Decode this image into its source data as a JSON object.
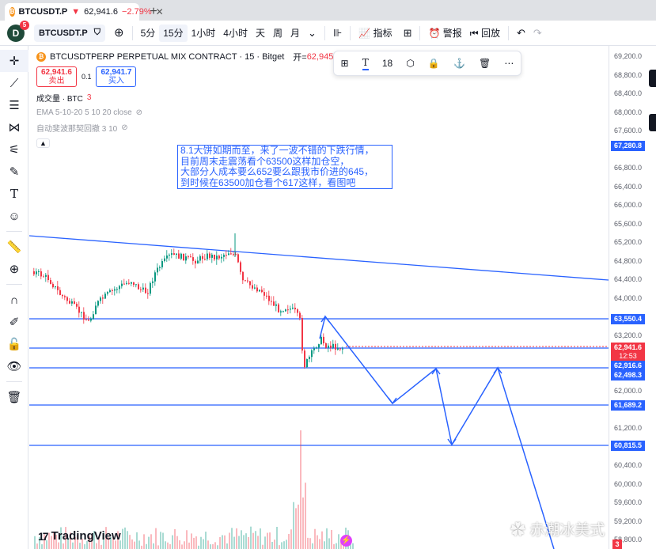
{
  "browser": {
    "tab_symbol": "BTCUSDT.P",
    "tab_price": "62,941.6",
    "tab_change": "−2.79%",
    "tab_close": "✕",
    "new_tab": "+"
  },
  "toolbar": {
    "avatar_letter": "D",
    "notification_count": "5",
    "symbol": "BTCUSDT.P",
    "intervals": [
      "5分",
      "15分",
      "1小时",
      "4小时",
      "天",
      "周",
      "月"
    ],
    "active_interval": "15分",
    "indicators_label": "指标",
    "alert_label": "警报",
    "replay_label": "回放"
  },
  "legend": {
    "title": "BTCUSDTPERP PERPETUAL MIX CONTRACT · 15 · Bitget",
    "open_label": "开=",
    "open_value": "62,945.5",
    "sell_price": "62,941.6",
    "sell_label": "卖出",
    "spread": "0.1",
    "buy_price": "62,941.7",
    "buy_label": "买入",
    "volume_label": "成交量 · BTC",
    "volume_value": "3",
    "ema_label": "EMA 5-10-20 5 10 20 close",
    "wave_label": "自动斐波那契回撤 3 10"
  },
  "drawing_toolbar": {
    "font_size": "18"
  },
  "annotation": {
    "lines": [
      "8.1大饼如期而至，来了一波不错的下跌行情，",
      "目前周末走震荡看个63500这样加仓空，",
      "大部分人成本要么652要么跟我市价进的645，",
      "到时候在63500加仓看个617这样，看图吧"
    ]
  },
  "price_scale": {
    "ticks": [
      "69,200.0",
      "68,800.0",
      "68,400.0",
      "68,000.0",
      "67,600.0",
      "66,800.0",
      "66,400.0",
      "66,000.0",
      "65,600.0",
      "65,200.0",
      "64,800.0",
      "64,400.0",
      "64,000.0",
      "63,200.0",
      "62,800.0",
      "62,000.0",
      "61,200.0",
      "60,400.0",
      "60,000.0",
      "59,600.0",
      "59,200.0",
      "58,800.0"
    ],
    "labels": {
      "top": "67,280.8",
      "l1": "63,550.4",
      "current": "62,941.6",
      "countdown": "12:53",
      "l2": "62,916.6",
      "l3": "62,498.3",
      "l4": "61,689.2",
      "l5": "60,815.5",
      "bottom_badge": "3"
    }
  },
  "branding": {
    "tv_logo": "TradingView",
    "watermark": "赤潮冰美式"
  },
  "colors": {
    "accent": "#2962ff",
    "up": "#089981",
    "down": "#f23645"
  }
}
